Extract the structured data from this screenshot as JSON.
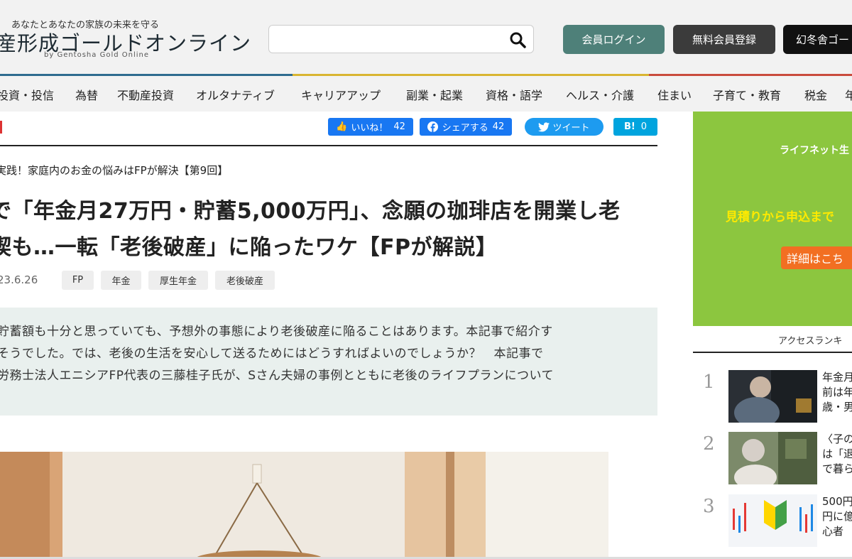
{
  "header": {
    "tagline": "あなたとあなたの家族の未来を守る",
    "logo": "産形成ゴールドオンライン",
    "logo_sub": "by Gentosha Gold Online",
    "search_placeholder": "",
    "buttons": {
      "login": "会員ログイン",
      "register": "無料会員登録",
      "gentosha": "幻冬舎ゴー"
    },
    "colors": {
      "login": "#4e8079",
      "register": "#3b3b3b",
      "gentosha": "#111111"
    }
  },
  "nav": {
    "items": [
      "投資・投信",
      "為替",
      "不動産投資",
      "オルタナティブ",
      "キャリアアップ",
      "副業・起業",
      "資格・語学",
      "ヘルス・介護",
      "住まい",
      "子育て・教育",
      "税金",
      "年"
    ]
  },
  "article": {
    "share": {
      "like_label": "いいね！",
      "like_count": "42",
      "fb_label": "シェアする",
      "fb_count": "42",
      "tweet_label": "ツイート",
      "hatena_label": "B!",
      "hatena_count": "0"
    },
    "series": "実践！家庭内のお金の悩みはFPが解決【第9回】",
    "title_lines": [
      "で「年金月27万円・貯蓄5,000万円」、念願の珈琲店を開業し老",
      "喫も…一転「老後破産」に陥ったワケ【FPが解説】"
    ],
    "date": "23.6.26",
    "tags": [
      "FP",
      "年金",
      "厚生年金",
      "老後破産"
    ],
    "lead_lines": [
      "貯蓄額も十分と思っていても、予想外の事態により老後破産に陥ることはあります。本記事で紹介す",
      "そうでした。では、老後の生活を安心して送るためにはどうすればよいのでしょうか？　本記事で",
      "労務士法人エニシアFP代表の三藤桂子氏が、Sさん夫婦の事例とともに老後のライフプランについて"
    ]
  },
  "sidebar": {
    "ad": {
      "line1": "ライフネット生",
      "line2": "見積りから申込まで",
      "button": "詳細はこち"
    },
    "ranking_title": "アクセスランキ",
    "ranking": [
      {
        "rank": "1",
        "text": [
          "年金月",
          "前は年",
          "歳・男"
        ]
      },
      {
        "rank": "2",
        "text": [
          "〈子の",
          "は「退",
          "で暮ら"
        ]
      },
      {
        "rank": "3",
        "text": [
          "500円",
          "円に億",
          "心者"
        ]
      }
    ]
  }
}
